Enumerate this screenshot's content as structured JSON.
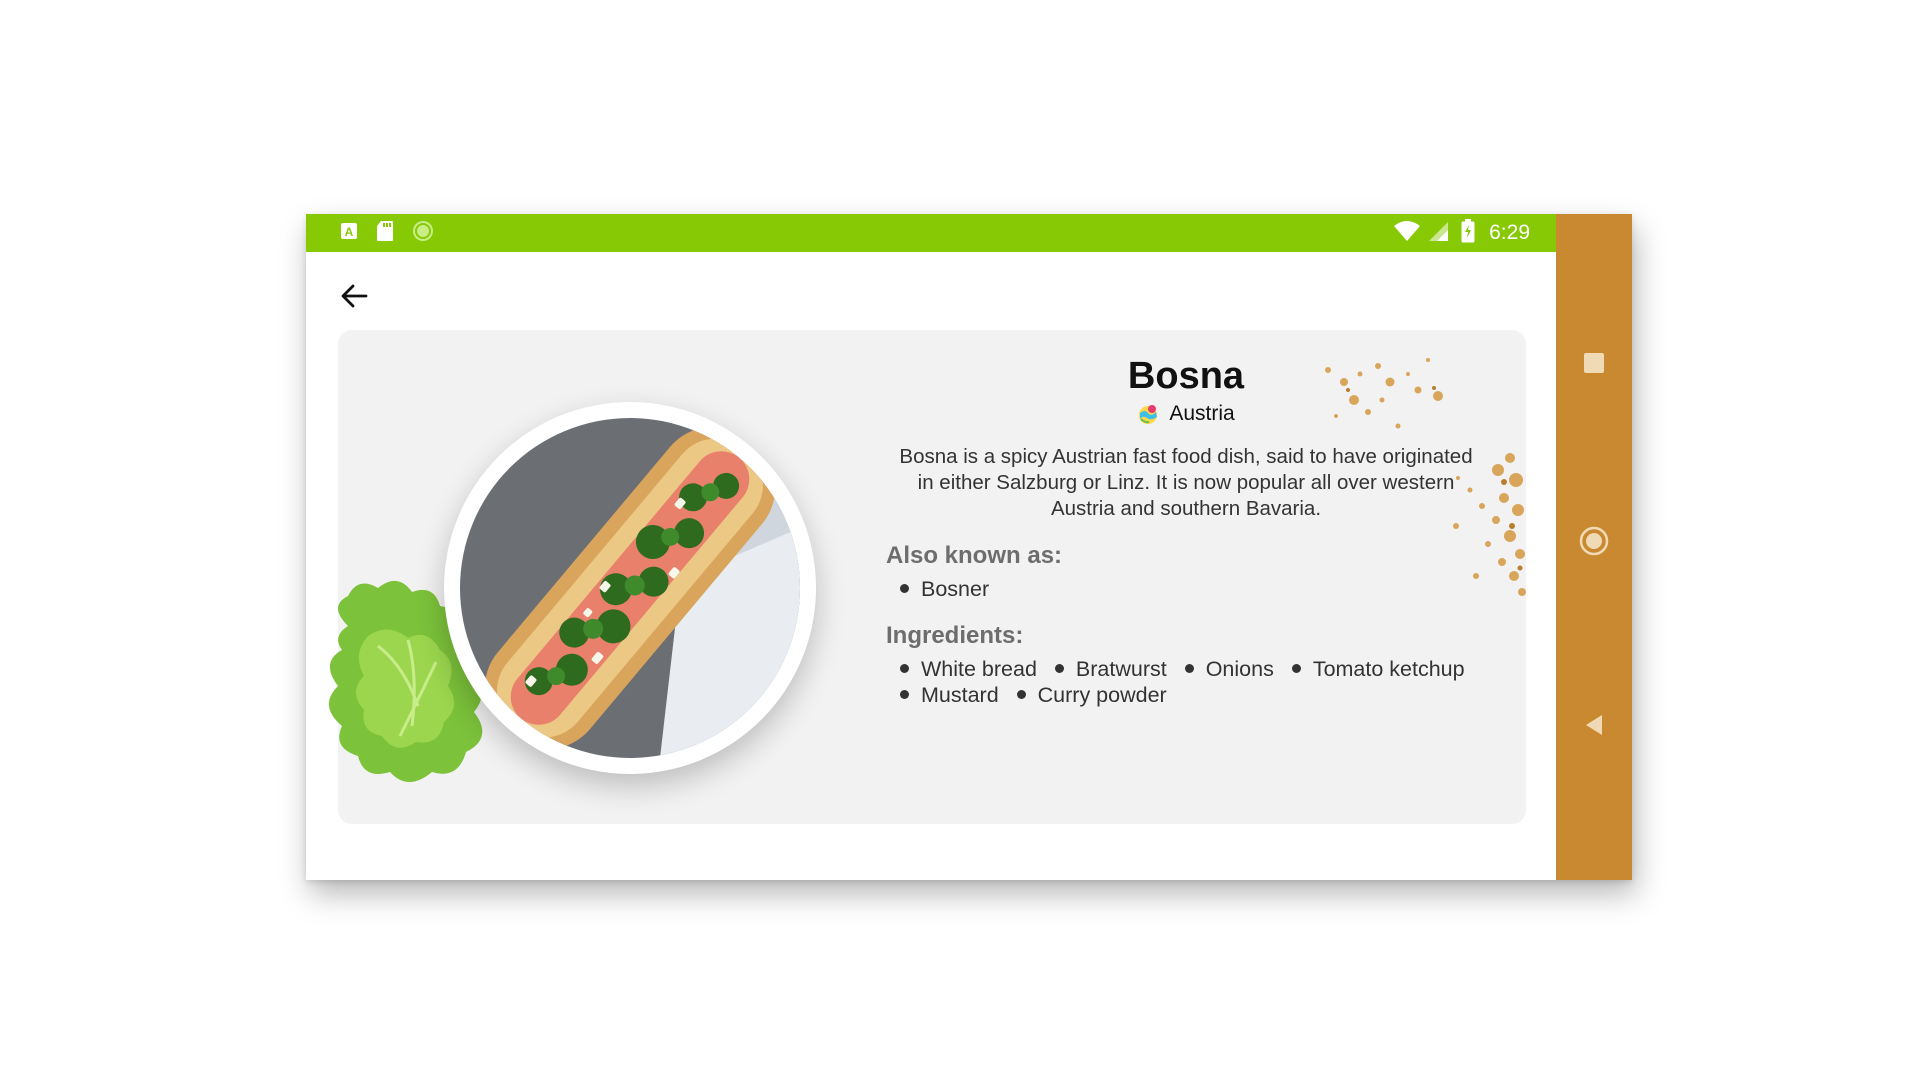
{
  "status_bar": {
    "time": "6:29",
    "left_icons": [
      "a-badge-icon",
      "sd-card-icon",
      "sync-circle-icon"
    ],
    "right_icons": [
      "wifi-icon",
      "signal-icon",
      "battery-charging-icon"
    ],
    "color": "#87c905"
  },
  "nav_bar": {
    "color": "#c98931",
    "buttons": [
      "recents-button",
      "home-button",
      "back-button"
    ]
  },
  "header": {
    "back_icon": "arrow-left-icon"
  },
  "dish": {
    "name": "Bosna",
    "country": "Austria",
    "description": "Bosna is a spicy Austrian fast food dish, said to have originated in either Salzburg or Linz. It is now popular all over western Austria and southern Bavaria.",
    "also_known_as_label": "Also known as:",
    "also_known_as": [
      "Bosner"
    ],
    "ingredients_label": "Ingredients:",
    "ingredients": [
      "White bread",
      "Bratwurst",
      "Onions",
      "Tomato ketchup",
      "Mustard",
      "Curry powder"
    ]
  }
}
